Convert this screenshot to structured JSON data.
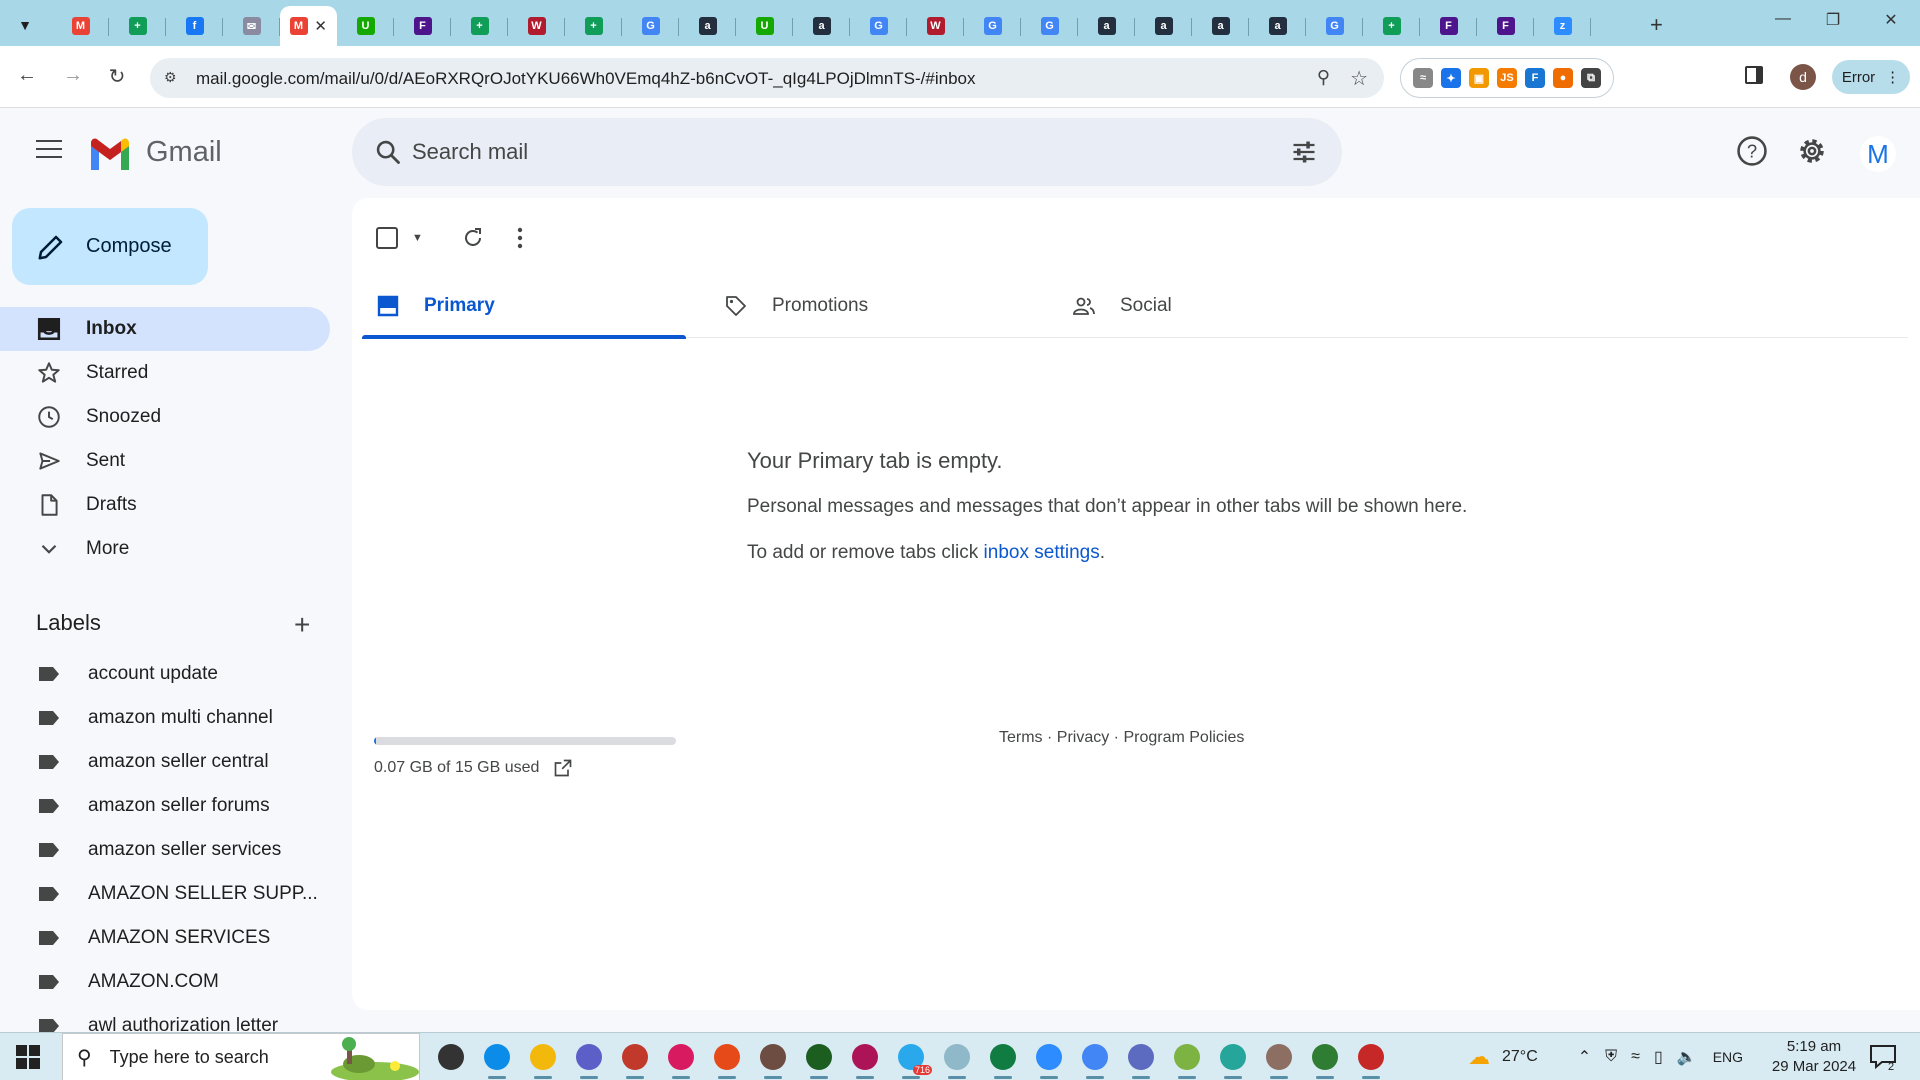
{
  "browser": {
    "url": "mail.google.com/mail/u/0/d/AEoRXRQrOJotYKU66Wh0VEmq4hZ-b6nCvOT-_qIg4LPOjDlmnTS-/#inbox",
    "error_label": "Error",
    "profile_letter": "d",
    "tabs": [
      {
        "icon": "gmail-favicon",
        "color": "#ea4335",
        "glyph": "M"
      },
      {
        "icon": "sheets-favicon",
        "color": "#0f9d58",
        "glyph": "+"
      },
      {
        "icon": "facebook-favicon",
        "color": "#1877f2",
        "glyph": "f"
      },
      {
        "icon": "site-favicon",
        "color": "#8a8aa0",
        "glyph": "✉"
      },
      {
        "icon": "gmail-favicon-active",
        "color": "#ea4335",
        "glyph": "M",
        "active": true
      },
      {
        "icon": "upwork-favicon",
        "color": "#14a800",
        "glyph": "U"
      },
      {
        "icon": "fedex-favicon",
        "color": "#4d148c",
        "glyph": "F"
      },
      {
        "icon": "sheets-favicon",
        "color": "#0f9d58",
        "glyph": "+"
      },
      {
        "icon": "walmart-favicon",
        "color": "#b01c2e",
        "glyph": "W"
      },
      {
        "icon": "sheets-favicon",
        "color": "#0f9d58",
        "glyph": "+"
      },
      {
        "icon": "google-favicon",
        "color": "#4285f4",
        "glyph": "G"
      },
      {
        "icon": "amazon-favicon",
        "color": "#232f3e",
        "glyph": "a"
      },
      {
        "icon": "upwork-favicon",
        "color": "#14a800",
        "glyph": "U"
      },
      {
        "icon": "amazon-favicon",
        "color": "#232f3e",
        "glyph": "a"
      },
      {
        "icon": "google-favicon",
        "color": "#4285f4",
        "glyph": "G"
      },
      {
        "icon": "walmart-favicon",
        "color": "#b01c2e",
        "glyph": "W"
      },
      {
        "icon": "google-favicon",
        "color": "#4285f4",
        "glyph": "G"
      },
      {
        "icon": "google-favicon",
        "color": "#4285f4",
        "glyph": "G"
      },
      {
        "icon": "amazon-favicon",
        "color": "#232f3e",
        "glyph": "a"
      },
      {
        "icon": "amazon-favicon",
        "color": "#232f3e",
        "glyph": "a"
      },
      {
        "icon": "amazon-favicon",
        "color": "#232f3e",
        "glyph": "a"
      },
      {
        "icon": "amazon-favicon",
        "color": "#232f3e",
        "glyph": "a"
      },
      {
        "icon": "google-favicon",
        "color": "#4285f4",
        "glyph": "G"
      },
      {
        "icon": "sheets-favicon",
        "color": "#0f9d58",
        "glyph": "+"
      },
      {
        "icon": "fedex-favicon",
        "color": "#4d148c",
        "glyph": "F"
      },
      {
        "icon": "fedex-favicon",
        "color": "#4d148c",
        "glyph": "F"
      },
      {
        "icon": "zoom-favicon",
        "color": "#2d8cff",
        "glyph": "z"
      }
    ],
    "extensions": [
      {
        "icon": "extension-1-icon",
        "color": "#888888",
        "glyph": "≈"
      },
      {
        "icon": "extension-2-icon",
        "color": "#1a73e8",
        "glyph": "✦"
      },
      {
        "icon": "extension-3-icon",
        "color": "#f29900",
        "glyph": "▣"
      },
      {
        "icon": "extension-js-icon",
        "color": "#f57c00",
        "glyph": "JS"
      },
      {
        "icon": "extension-fba-icon",
        "color": "#1976d2",
        "glyph": "F"
      },
      {
        "icon": "extension-6-icon",
        "color": "#ef6c00",
        "glyph": "●"
      },
      {
        "icon": "puzzle-icon",
        "color": "#444444",
        "glyph": "⧉"
      }
    ]
  },
  "gmail": {
    "brand": "Gmail",
    "search_placeholder": "Search mail",
    "avatar_letter": "M",
    "compose_label": "Compose",
    "nav": [
      {
        "key": "inbox",
        "label": "Inbox",
        "active": true
      },
      {
        "key": "starred",
        "label": "Starred"
      },
      {
        "key": "snoozed",
        "label": "Snoozed"
      },
      {
        "key": "sent",
        "label": "Sent"
      },
      {
        "key": "drafts",
        "label": "Drafts"
      },
      {
        "key": "more",
        "label": "More"
      }
    ],
    "labels_title": "Labels",
    "labels": [
      "account update",
      "amazon multi channel",
      "amazon seller central",
      "amazon seller forums",
      "amazon seller services",
      "AMAZON SELLER SUPP...",
      "AMAZON SERVICES",
      "AMAZON.COM",
      "awl authorization letter"
    ],
    "category_tabs": [
      "Primary",
      "Promotions",
      "Social"
    ],
    "empty": {
      "title": "Your Primary tab is empty.",
      "line1": "Personal messages and messages that don’t appear in other tabs will be shown here.",
      "line2_prefix": "To add or remove tabs click ",
      "line2_link": "inbox settings",
      "line2_suffix": "."
    },
    "storage": {
      "text": "0.07 GB of 15 GB used",
      "fraction": 0.005
    },
    "footer": {
      "terms": "Terms",
      "privacy": "Privacy",
      "policies": "Program Policies",
      "sep": " · "
    }
  },
  "taskbar": {
    "search_placeholder": "Type here to search",
    "telegram_badge": "716",
    "weather": "27°C",
    "language": "ENG",
    "time": "5:19 am",
    "date": "29 Mar 2024",
    "notification_count": "2",
    "apps": [
      {
        "icon": "task-view-icon",
        "color": "#333333"
      },
      {
        "icon": "edge-icon",
        "color": "#0c8ce9"
      },
      {
        "icon": "file-explorer-icon",
        "color": "#f2b90c"
      },
      {
        "icon": "snipping-tool-icon",
        "color": "#5b5fc7"
      },
      {
        "icon": "chrome-profile-d-icon",
        "color": "#c0392b"
      },
      {
        "icon": "chrome-profile-d2-icon",
        "color": "#d81b60"
      },
      {
        "icon": "chrome-profile-3-icon",
        "color": "#e64a19"
      },
      {
        "icon": "chrome-profile-rc-icon",
        "color": "#6d4c41"
      },
      {
        "icon": "chrome-profile-dk-icon",
        "color": "#1b5e20"
      },
      {
        "icon": "chrome-profile-a-icon",
        "color": "#ad1457"
      },
      {
        "icon": "telegram-icon",
        "color": "#29a9eb"
      },
      {
        "icon": "notes-app-icon",
        "color": "#8fb8c8"
      },
      {
        "icon": "excel-icon",
        "color": "#107c41"
      },
      {
        "icon": "zoom-icon",
        "color": "#2d8cff"
      },
      {
        "icon": "chrome-icon",
        "color": "#4285f4"
      },
      {
        "icon": "chrome-profile-p1-icon",
        "color": "#5c6bc0"
      },
      {
        "icon": "chrome-profile-p2-icon",
        "color": "#7cb342"
      },
      {
        "icon": "chrome-profile-p3-icon",
        "color": "#26a69a"
      },
      {
        "icon": "chrome-profile-p4-icon",
        "color": "#8d6e63"
      },
      {
        "icon": "chrome-profile-d3-icon",
        "color": "#2e7d32"
      },
      {
        "icon": "chrome-profile-c-icon",
        "color": "#c62828"
      }
    ]
  }
}
